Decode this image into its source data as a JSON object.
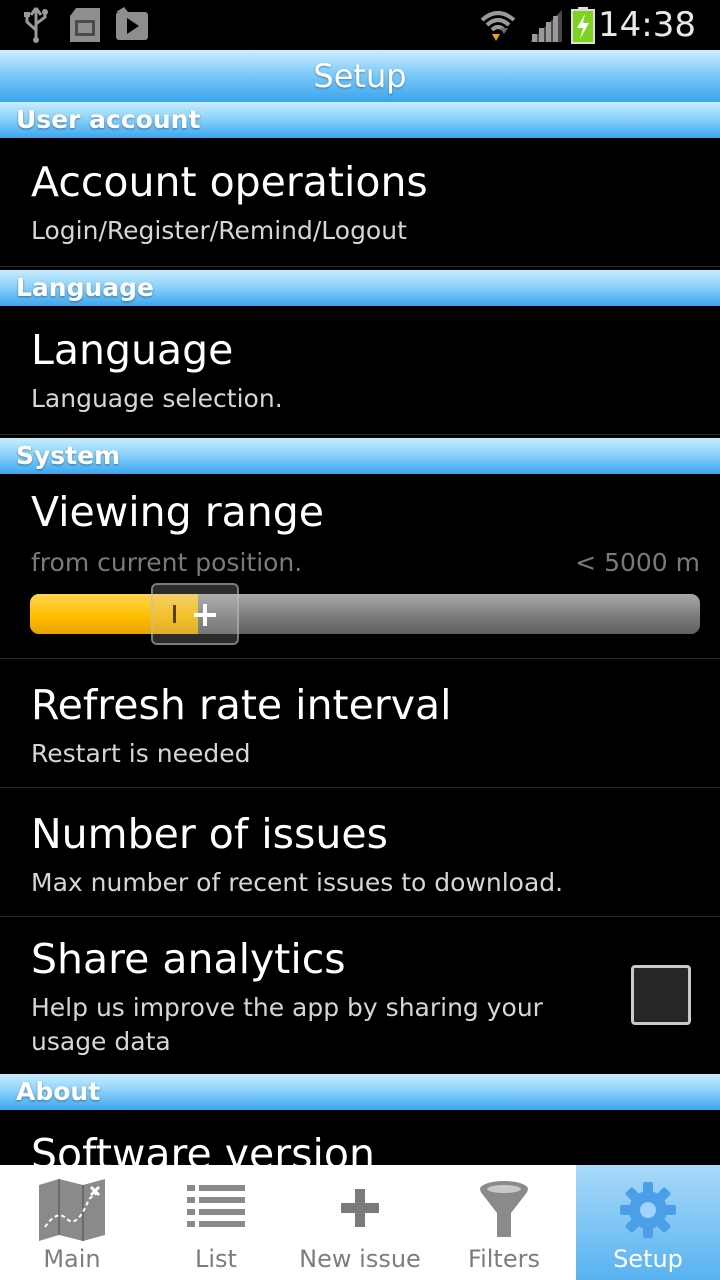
{
  "status_bar": {
    "time": "14:38"
  },
  "title": "Setup",
  "sections": {
    "user_account": "User account",
    "language": "Language",
    "system": "System",
    "about": "About"
  },
  "items": {
    "account": {
      "title": "Account operations",
      "subtitle": "Login/Register/Remind/Logout"
    },
    "language": {
      "title": "Language",
      "subtitle": "Language selection."
    },
    "viewing_range": {
      "title": "Viewing range",
      "subtitle": "from current position.",
      "value": "< 5000 m",
      "slider_fraction": 0.25
    },
    "refresh": {
      "title": "Refresh rate interval",
      "subtitle": "Restart is needed"
    },
    "issues": {
      "title": "Number of issues",
      "subtitle": "Max number of recent issues to download."
    },
    "analytics": {
      "title": "Share analytics",
      "subtitle_line1": "Help us improve the app by sharing your",
      "subtitle_line2": "usage data",
      "checked": false
    },
    "software": {
      "title": "Software version"
    }
  },
  "tabs": [
    {
      "label": "Main",
      "icon": "map-icon"
    },
    {
      "label": "List",
      "icon": "list-icon"
    },
    {
      "label": "New issue",
      "icon": "plus-icon"
    },
    {
      "label": "Filters",
      "icon": "funnel-icon"
    },
    {
      "label": "Setup",
      "icon": "gear-icon",
      "active": true
    }
  ]
}
